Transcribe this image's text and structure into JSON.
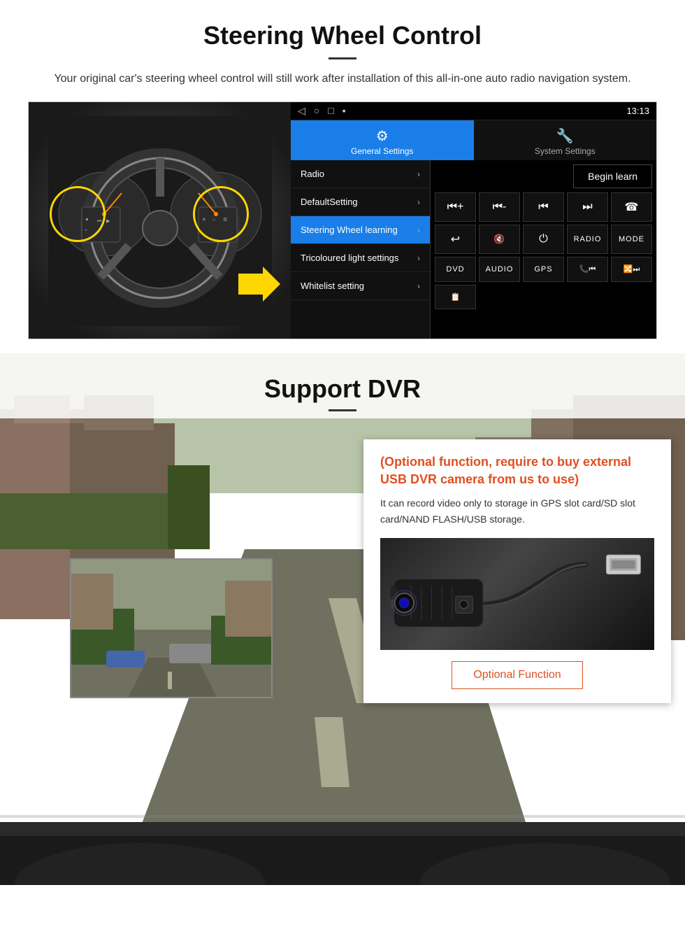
{
  "steering": {
    "title": "Steering Wheel Control",
    "description": "Your original car's steering wheel control will still work after installation of this all-in-one auto radio navigation system.",
    "statusbar": {
      "nav_icons": "◁  ○  □  ▪",
      "time": "13:13"
    },
    "tab_general": "General Settings",
    "tab_system": "System Settings",
    "menu_items": [
      {
        "label": "Radio",
        "active": false
      },
      {
        "label": "DefaultSetting",
        "active": false
      },
      {
        "label": "Steering Wheel learning",
        "active": true
      },
      {
        "label": "Tricoloured light settings",
        "active": false
      },
      {
        "label": "Whitelist setting",
        "active": false
      }
    ],
    "begin_learn_label": "Begin learn",
    "control_buttons": [
      "⏮+",
      "⏮-",
      "⏮",
      "⏭",
      "☎",
      "↩",
      "🔇",
      "⏻",
      "RADIO",
      "MODE",
      "DVD",
      "AUDIO",
      "GPS",
      "📞⏮",
      "🔀⏭"
    ],
    "extra_btn": "📋"
  },
  "dvr": {
    "title": "Support DVR",
    "info_title": "(Optional function, require to buy external USB DVR camera from us to use)",
    "info_desc": "It can record video only to storage in GPS slot card/SD slot card/NAND FLASH/USB storage.",
    "optional_function_label": "Optional Function"
  }
}
